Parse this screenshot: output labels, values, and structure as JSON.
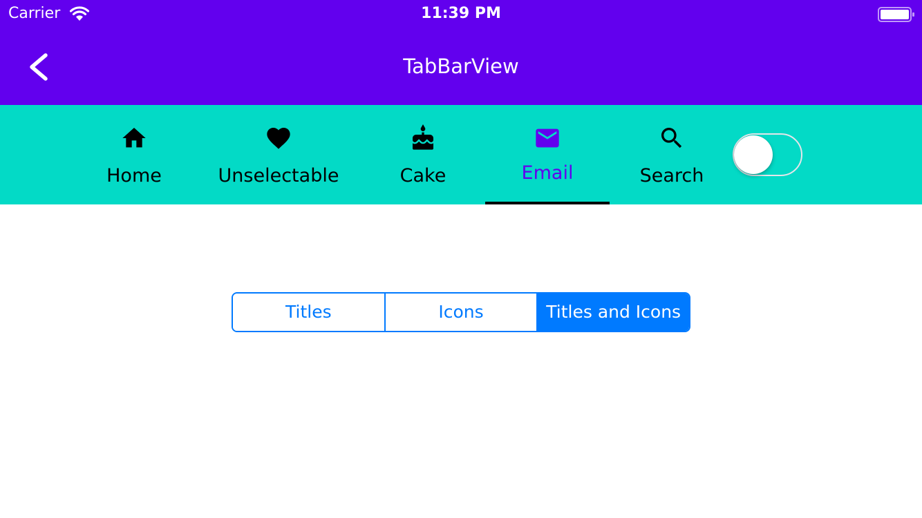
{
  "status_bar": {
    "carrier": "Carrier",
    "time": "11:39 PM",
    "wifi_icon": "wifi-icon",
    "battery_icon": "battery-icon"
  },
  "nav": {
    "title": "TabBarView",
    "back_icon": "chevron-left-icon"
  },
  "tabs": [
    {
      "label": "Home",
      "icon": "home-icon",
      "selected": false
    },
    {
      "label": "Unselectable",
      "icon": "heart-icon",
      "selected": false
    },
    {
      "label": "Cake",
      "icon": "cake-icon",
      "selected": false
    },
    {
      "label": "Email",
      "icon": "email-icon",
      "selected": true
    },
    {
      "label": "Search",
      "icon": "search-icon",
      "selected": false
    }
  ],
  "toggle": {
    "on": false
  },
  "segmented_control": {
    "options": [
      "Titles",
      "Icons",
      "Titles and Icons"
    ],
    "selected_index": 2
  },
  "colors": {
    "app_bar": "#6200ee",
    "tab_bar": "#03dac6",
    "selected_tab": "#6200ee",
    "tab_indicator": "#000000",
    "segment_accent": "#007aff"
  }
}
